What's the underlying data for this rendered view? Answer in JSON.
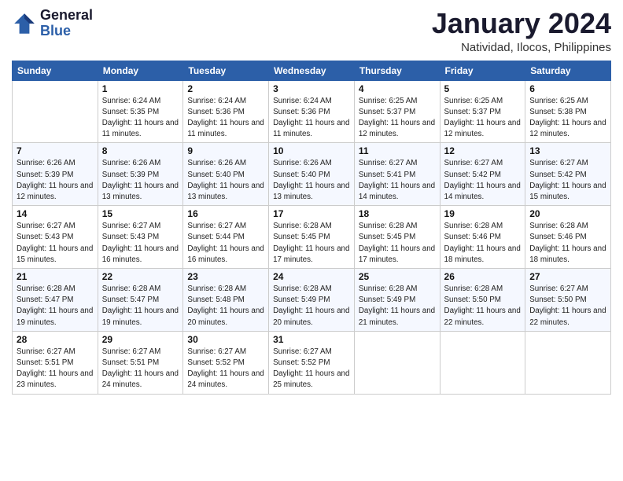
{
  "logo": {
    "text_general": "General",
    "text_blue": "Blue"
  },
  "header": {
    "month": "January 2024",
    "location": "Natividad, Ilocos, Philippines"
  },
  "weekdays": [
    "Sunday",
    "Monday",
    "Tuesday",
    "Wednesday",
    "Thursday",
    "Friday",
    "Saturday"
  ],
  "weeks": [
    [
      {
        "day": "",
        "sunrise": "",
        "sunset": "",
        "daylight": ""
      },
      {
        "day": "1",
        "sunrise": "Sunrise: 6:24 AM",
        "sunset": "Sunset: 5:35 PM",
        "daylight": "Daylight: 11 hours and 11 minutes."
      },
      {
        "day": "2",
        "sunrise": "Sunrise: 6:24 AM",
        "sunset": "Sunset: 5:36 PM",
        "daylight": "Daylight: 11 hours and 11 minutes."
      },
      {
        "day": "3",
        "sunrise": "Sunrise: 6:24 AM",
        "sunset": "Sunset: 5:36 PM",
        "daylight": "Daylight: 11 hours and 11 minutes."
      },
      {
        "day": "4",
        "sunrise": "Sunrise: 6:25 AM",
        "sunset": "Sunset: 5:37 PM",
        "daylight": "Daylight: 11 hours and 12 minutes."
      },
      {
        "day": "5",
        "sunrise": "Sunrise: 6:25 AM",
        "sunset": "Sunset: 5:37 PM",
        "daylight": "Daylight: 11 hours and 12 minutes."
      },
      {
        "day": "6",
        "sunrise": "Sunrise: 6:25 AM",
        "sunset": "Sunset: 5:38 PM",
        "daylight": "Daylight: 11 hours and 12 minutes."
      }
    ],
    [
      {
        "day": "7",
        "sunrise": "Sunrise: 6:26 AM",
        "sunset": "Sunset: 5:39 PM",
        "daylight": "Daylight: 11 hours and 12 minutes."
      },
      {
        "day": "8",
        "sunrise": "Sunrise: 6:26 AM",
        "sunset": "Sunset: 5:39 PM",
        "daylight": "Daylight: 11 hours and 13 minutes."
      },
      {
        "day": "9",
        "sunrise": "Sunrise: 6:26 AM",
        "sunset": "Sunset: 5:40 PM",
        "daylight": "Daylight: 11 hours and 13 minutes."
      },
      {
        "day": "10",
        "sunrise": "Sunrise: 6:26 AM",
        "sunset": "Sunset: 5:40 PM",
        "daylight": "Daylight: 11 hours and 13 minutes."
      },
      {
        "day": "11",
        "sunrise": "Sunrise: 6:27 AM",
        "sunset": "Sunset: 5:41 PM",
        "daylight": "Daylight: 11 hours and 14 minutes."
      },
      {
        "day": "12",
        "sunrise": "Sunrise: 6:27 AM",
        "sunset": "Sunset: 5:42 PM",
        "daylight": "Daylight: 11 hours and 14 minutes."
      },
      {
        "day": "13",
        "sunrise": "Sunrise: 6:27 AM",
        "sunset": "Sunset: 5:42 PM",
        "daylight": "Daylight: 11 hours and 15 minutes."
      }
    ],
    [
      {
        "day": "14",
        "sunrise": "Sunrise: 6:27 AM",
        "sunset": "Sunset: 5:43 PM",
        "daylight": "Daylight: 11 hours and 15 minutes."
      },
      {
        "day": "15",
        "sunrise": "Sunrise: 6:27 AM",
        "sunset": "Sunset: 5:43 PM",
        "daylight": "Daylight: 11 hours and 16 minutes."
      },
      {
        "day": "16",
        "sunrise": "Sunrise: 6:27 AM",
        "sunset": "Sunset: 5:44 PM",
        "daylight": "Daylight: 11 hours and 16 minutes."
      },
      {
        "day": "17",
        "sunrise": "Sunrise: 6:28 AM",
        "sunset": "Sunset: 5:45 PM",
        "daylight": "Daylight: 11 hours and 17 minutes."
      },
      {
        "day": "18",
        "sunrise": "Sunrise: 6:28 AM",
        "sunset": "Sunset: 5:45 PM",
        "daylight": "Daylight: 11 hours and 17 minutes."
      },
      {
        "day": "19",
        "sunrise": "Sunrise: 6:28 AM",
        "sunset": "Sunset: 5:46 PM",
        "daylight": "Daylight: 11 hours and 18 minutes."
      },
      {
        "day": "20",
        "sunrise": "Sunrise: 6:28 AM",
        "sunset": "Sunset: 5:46 PM",
        "daylight": "Daylight: 11 hours and 18 minutes."
      }
    ],
    [
      {
        "day": "21",
        "sunrise": "Sunrise: 6:28 AM",
        "sunset": "Sunset: 5:47 PM",
        "daylight": "Daylight: 11 hours and 19 minutes."
      },
      {
        "day": "22",
        "sunrise": "Sunrise: 6:28 AM",
        "sunset": "Sunset: 5:47 PM",
        "daylight": "Daylight: 11 hours and 19 minutes."
      },
      {
        "day": "23",
        "sunrise": "Sunrise: 6:28 AM",
        "sunset": "Sunset: 5:48 PM",
        "daylight": "Daylight: 11 hours and 20 minutes."
      },
      {
        "day": "24",
        "sunrise": "Sunrise: 6:28 AM",
        "sunset": "Sunset: 5:49 PM",
        "daylight": "Daylight: 11 hours and 20 minutes."
      },
      {
        "day": "25",
        "sunrise": "Sunrise: 6:28 AM",
        "sunset": "Sunset: 5:49 PM",
        "daylight": "Daylight: 11 hours and 21 minutes."
      },
      {
        "day": "26",
        "sunrise": "Sunrise: 6:28 AM",
        "sunset": "Sunset: 5:50 PM",
        "daylight": "Daylight: 11 hours and 22 minutes."
      },
      {
        "day": "27",
        "sunrise": "Sunrise: 6:27 AM",
        "sunset": "Sunset: 5:50 PM",
        "daylight": "Daylight: 11 hours and 22 minutes."
      }
    ],
    [
      {
        "day": "28",
        "sunrise": "Sunrise: 6:27 AM",
        "sunset": "Sunset: 5:51 PM",
        "daylight": "Daylight: 11 hours and 23 minutes."
      },
      {
        "day": "29",
        "sunrise": "Sunrise: 6:27 AM",
        "sunset": "Sunset: 5:51 PM",
        "daylight": "Daylight: 11 hours and 24 minutes."
      },
      {
        "day": "30",
        "sunrise": "Sunrise: 6:27 AM",
        "sunset": "Sunset: 5:52 PM",
        "daylight": "Daylight: 11 hours and 24 minutes."
      },
      {
        "day": "31",
        "sunrise": "Sunrise: 6:27 AM",
        "sunset": "Sunset: 5:52 PM",
        "daylight": "Daylight: 11 hours and 25 minutes."
      },
      {
        "day": "",
        "sunrise": "",
        "sunset": "",
        "daylight": ""
      },
      {
        "day": "",
        "sunrise": "",
        "sunset": "",
        "daylight": ""
      },
      {
        "day": "",
        "sunrise": "",
        "sunset": "",
        "daylight": ""
      }
    ]
  ]
}
